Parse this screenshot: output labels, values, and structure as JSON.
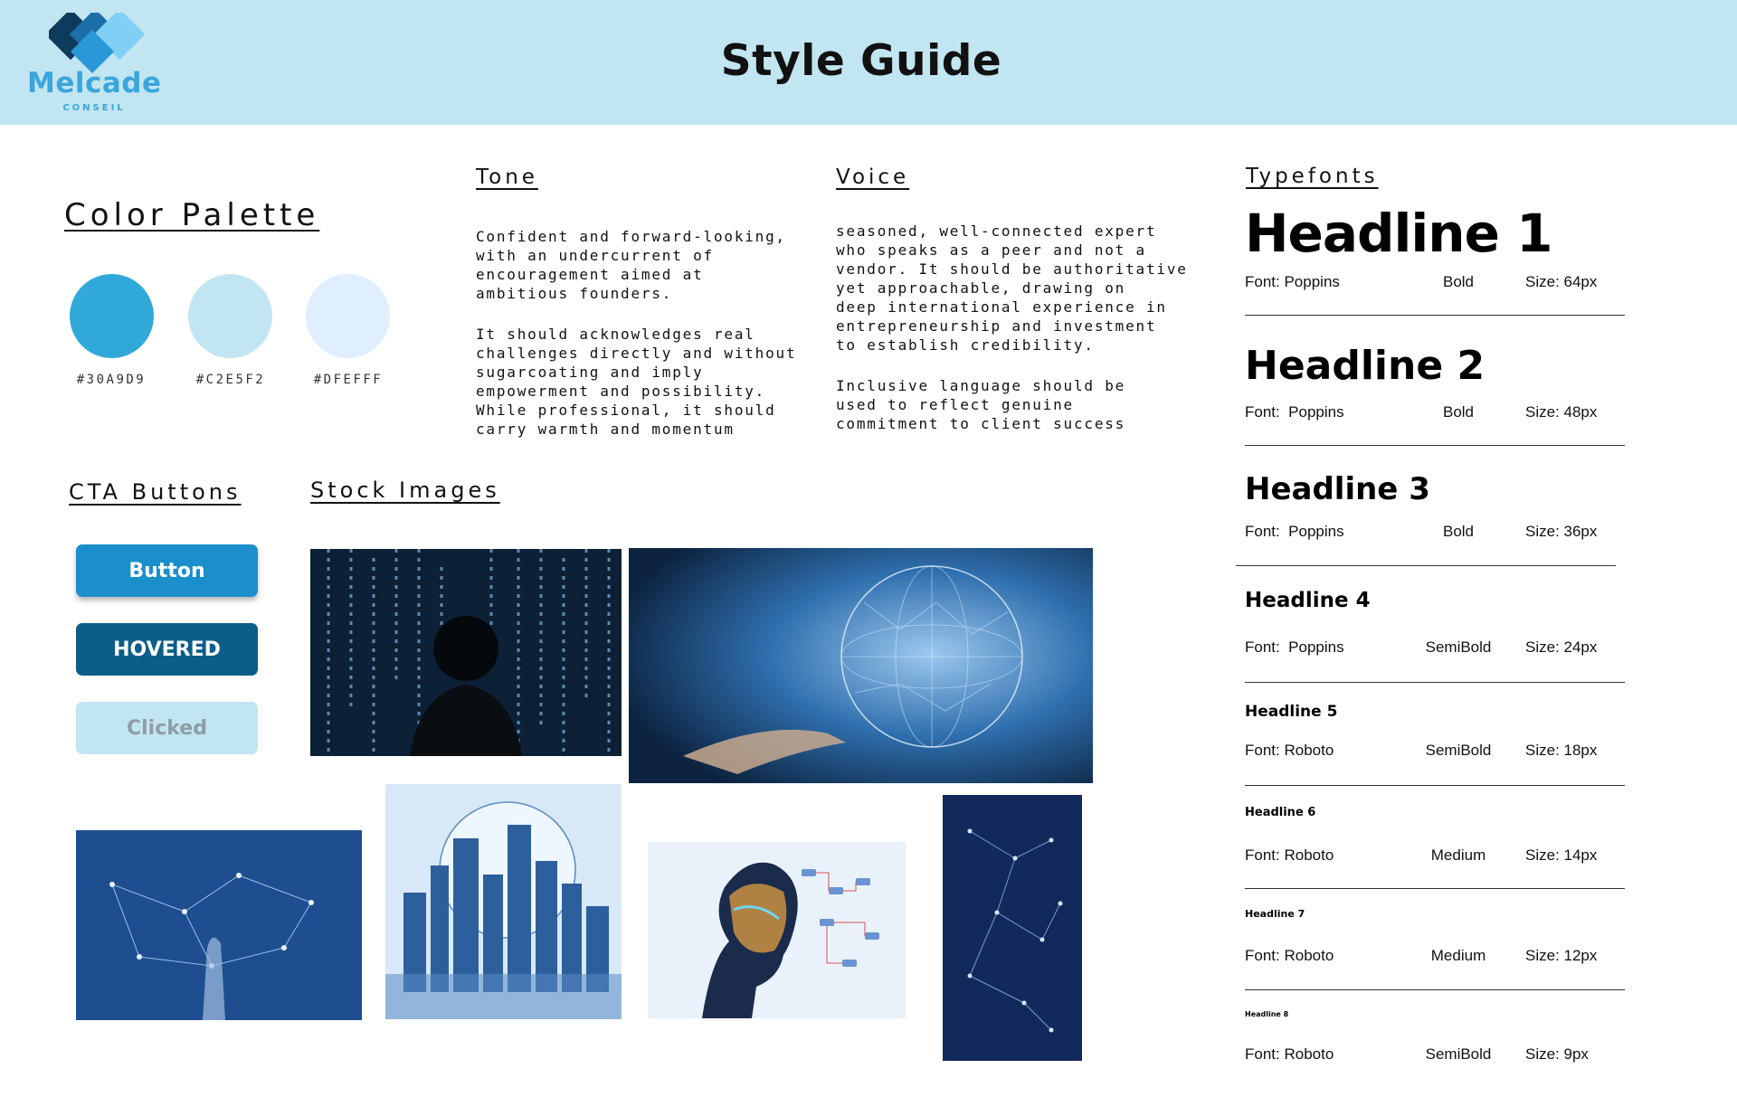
{
  "header": {
    "title": "Style Guide",
    "logo_name": "Melcade",
    "logo_sub": "CONSEIL"
  },
  "colors": {
    "header_bg": "#c2e5f2",
    "brand_blue": "#1a8fcb",
    "hover_blue": "#0a5e88"
  },
  "palette": {
    "title": "Color Palette",
    "swatches": [
      {
        "hex": "#30A9D9",
        "label": "#30A9D9"
      },
      {
        "hex": "#C2E5F2",
        "label": "#C2E5F2"
      },
      {
        "hex": "#DFEFFF",
        "label": "#DFEFFF"
      }
    ]
  },
  "tone": {
    "title": "Tone",
    "paragraph1": [
      "Confident and forward-looking,",
      "with an undercurrent of",
      "encouragement aimed at",
      "ambitious founders."
    ],
    "paragraph2": [
      "It should acknowledges real",
      "challenges directly and without",
      "sugarcoating and imply",
      "empowerment and possibility.",
      "While professional, it should",
      "carry warmth and momentum"
    ]
  },
  "voice": {
    "title": "Voice",
    "paragraph1": [
      "seasoned, well-connected expert",
      "who speaks as a peer and not a",
      "vendor. It should be authoritative",
      "yet approachable, drawing on",
      "deep international experience in",
      "entrepreneurship and investment",
      "to establish credibility."
    ],
    "paragraph2": [
      "Inclusive language should be",
      "used to reflect genuine",
      "commitment to client success"
    ]
  },
  "cta": {
    "title": "CTA Buttons",
    "default_label": "Button",
    "hover_label": "HOVERED",
    "clicked_label": "Clicked"
  },
  "stock": {
    "title": "Stock Images",
    "images": [
      "person-data-rain-image",
      "digital-globe-hand-image",
      "network-hand-image",
      "city-globe-image",
      "ai-head-profile-image",
      "constellation-network-image"
    ]
  },
  "typefonts": {
    "title": "Typefonts",
    "rows": [
      {
        "name": "Headline 1",
        "font": "Font: Poppins",
        "weight": "Bold",
        "size": "Size: 64px"
      },
      {
        "name": "Headline 2",
        "font": "Font:  Poppins",
        "weight": "Bold",
        "size": "Size: 48px"
      },
      {
        "name": "Headline 3",
        "font": "Font:  Poppins",
        "weight": "Bold",
        "size": "Size: 36px"
      },
      {
        "name": "Headline 4",
        "font": "Font:  Poppins",
        "weight": "SemiBold",
        "size": "Size: 24px"
      },
      {
        "name": "Headline 5",
        "font": "Font: Roboto",
        "weight": "SemiBold",
        "size": "Size: 18px"
      },
      {
        "name": "Headline 6",
        "font": "Font: Roboto",
        "weight": "Medium",
        "size": "Size: 14px"
      },
      {
        "name": "Headline 7",
        "font": "Font: Roboto",
        "weight": "Medium",
        "size": "Size: 12px"
      },
      {
        "name": "Headline 8",
        "font": "Font: Roboto",
        "weight": "SemiBold",
        "size": "Size: 9px"
      }
    ]
  }
}
